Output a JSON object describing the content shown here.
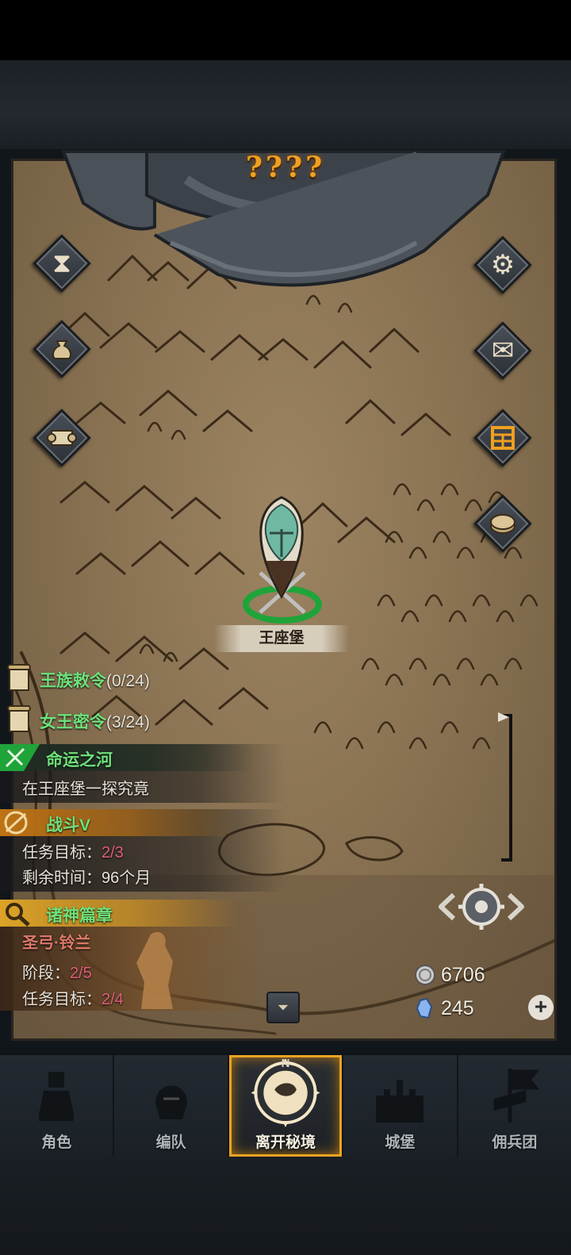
{
  "map": {
    "title": "????",
    "castle_label": "王座堡"
  },
  "left_buttons": [
    {
      "name": "hourglass-icon"
    },
    {
      "name": "money-bag-icon"
    },
    {
      "name": "scroll-icon"
    }
  ],
  "right_buttons": [
    {
      "name": "gear-icon"
    },
    {
      "name": "mail-icon"
    },
    {
      "name": "calendar-icon"
    },
    {
      "name": "coin-icon"
    }
  ],
  "quests": {
    "royal_edict": {
      "name": "王族敕令",
      "progress": "(0/24)"
    },
    "queen_order": {
      "name": "女王密令",
      "progress": "(3/24)"
    },
    "main": {
      "title": "命运之河",
      "desc": "在王座堡一探究竟"
    },
    "battle": {
      "title": "战斗V",
      "target_label": "任务目标：",
      "target_value": "2/3",
      "time_label": "剩余时间：",
      "time_value": "96个月"
    },
    "gods": {
      "title": "诸神篇章",
      "subtitle": "圣弓·铃兰",
      "stage_label": "阶段：",
      "stage_value": "2/5",
      "target_label": "任务目标：",
      "target_value": "2/4"
    }
  },
  "currency": {
    "silver": "6706",
    "crystal": "245"
  },
  "bottom_nav": [
    {
      "label": "角色",
      "icon": "knight-icon"
    },
    {
      "label": "编队",
      "icon": "helmet-icon"
    },
    {
      "label": "离开秘境",
      "icon": "compass-icon",
      "compass_letter": "N"
    },
    {
      "label": "城堡",
      "icon": "castle-icon"
    },
    {
      "label": "佣兵团",
      "icon": "banner-icon"
    }
  ],
  "colors": {
    "accent_gold": "#e8a322",
    "quest_green": "#6ee07a",
    "quest_red": "#e0607a",
    "title_orange": "#f0a020"
  }
}
